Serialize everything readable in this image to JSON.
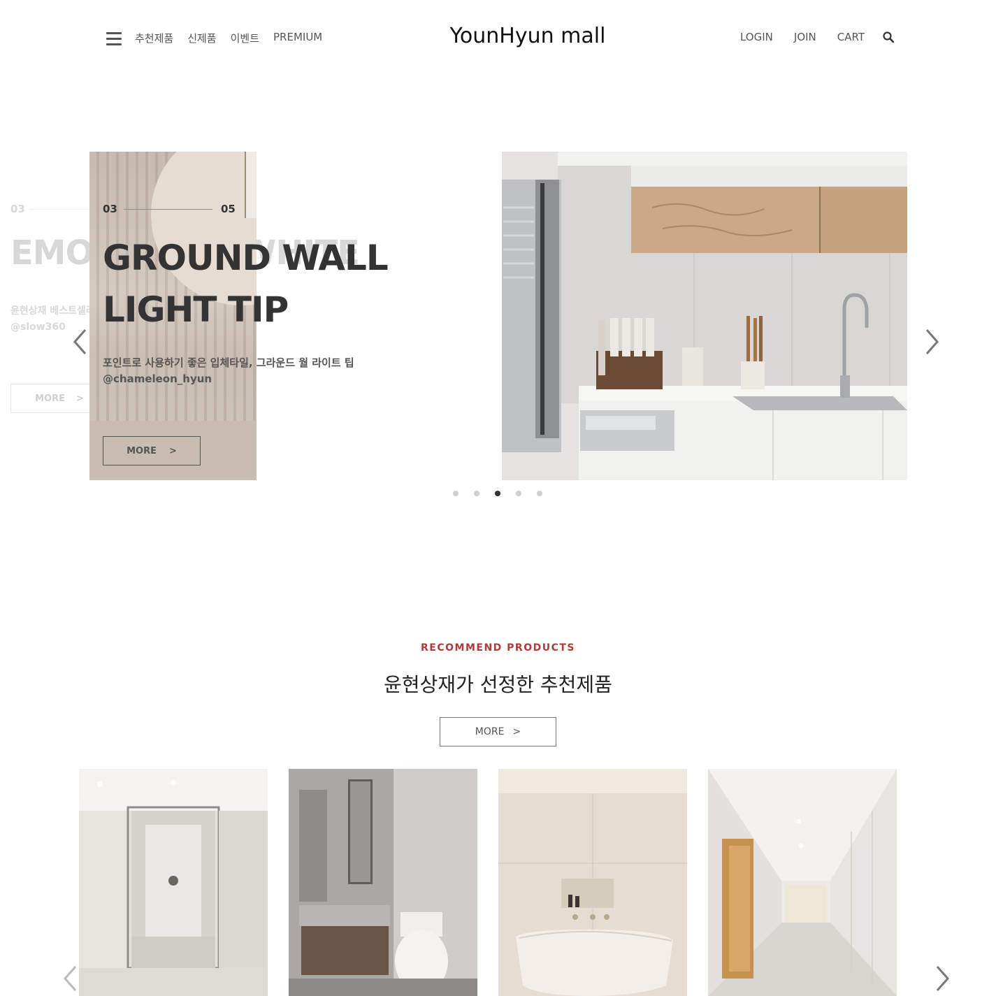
{
  "header": {
    "logo": "YounHyun mall",
    "nav_left": [
      "추천제품",
      "신제품",
      "이벤트",
      "PREMIUM"
    ],
    "nav_right": [
      "LOGIN",
      "JOIN",
      "CART"
    ],
    "icons": {
      "menu": "hamburger-icon",
      "search": "search-icon"
    }
  },
  "hero": {
    "ghost_slide": {
      "num": "03",
      "title": "EMOTIONAL WHITE",
      "desc_line1": "윤현상재 베스트셀러",
      "desc_line2": "@slow360",
      "more": "MORE",
      "more_arrow": ">"
    },
    "active_slide": {
      "num_current": "03",
      "num_total": "05",
      "title_line1": "GROUND WALL",
      "title_line2": "LIGHT TIP",
      "desc_line1": "포인트로 사용하기 좋은 입체타일, 그라운드 월 라이트 팁",
      "desc_line2": "@chameleon_hyun",
      "more": "MORE",
      "more_arrow": ">"
    },
    "dots_count": 5,
    "active_dot": 3
  },
  "recommend": {
    "eyebrow": "RECOMMEND PRODUCTS",
    "title": "윤현상재가 선정한 추천제품",
    "more": "MORE",
    "more_arrow": ">"
  },
  "colors": {
    "accent": "#b03b3b",
    "text": "#333333",
    "muted": "#555555"
  }
}
